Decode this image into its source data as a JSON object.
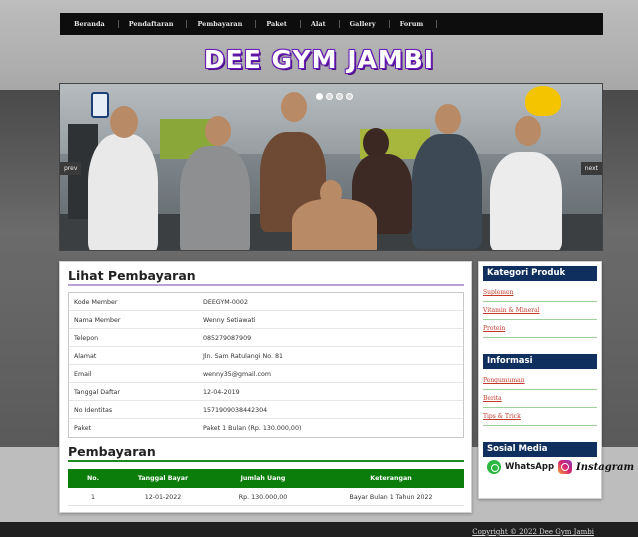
{
  "nav": {
    "items": [
      "Beranda",
      "Pendaftaran",
      "Pembayaran",
      "Paket",
      "Alat",
      "Gallery",
      "Forum"
    ]
  },
  "site": {
    "logo": "DEE GYM JAMBI"
  },
  "slider": {
    "prev_label": "prev",
    "next_label": "next"
  },
  "main": {
    "title": "Lihat Pembayaran",
    "rows": [
      {
        "label": "Kode Member",
        "value": "DEEGYM-0002"
      },
      {
        "label": "Nama Member",
        "value": "Wenny Setiawati"
      },
      {
        "label": "Telepon",
        "value": "085279087909"
      },
      {
        "label": "Alamat",
        "value": "Jln. Sam Ratulangi No. 81"
      },
      {
        "label": "Email",
        "value": "wenny35@gmail.com"
      },
      {
        "label": "Tanggal Daftar",
        "value": "12-04-2019"
      },
      {
        "label": "No Identitas",
        "value": "1571909038442304"
      },
      {
        "label": "Paket",
        "value": "Paket 1 Bulan (Rp. 130.000,00)"
      }
    ],
    "payment_title": "Pembayaran",
    "payment_table": {
      "headers": [
        "No.",
        "Tanggal Bayar",
        "Jumlah Uang",
        "Keterangan"
      ],
      "rows": [
        [
          "1",
          "12-01-2022",
          "Rp. 130.000,00",
          "Bayar Bulan 1 Tahun 2022"
        ]
      ]
    }
  },
  "sidebar": {
    "kategori_title": "Kategori Produk",
    "kategori": [
      "Suplemen",
      "Vitamin & Mineral",
      "Protein"
    ],
    "info_title": "Informasi",
    "info": [
      "Pengumuman",
      "Berita",
      "Tips & Trick"
    ],
    "social_title": "Sosial Media",
    "whatsapp_label": "WhatsApp",
    "instagram_label": "Instagram"
  },
  "footer": {
    "copyright": "Copyright © 2022 Dee Gym Jambi"
  },
  "colors": {
    "nav_bg": "#0d0d0d",
    "sidebar_head": "#0f2f5e",
    "table_head": "#0a7d0a",
    "link": "#c0392b",
    "logo_outline": "#6a1fb5"
  }
}
